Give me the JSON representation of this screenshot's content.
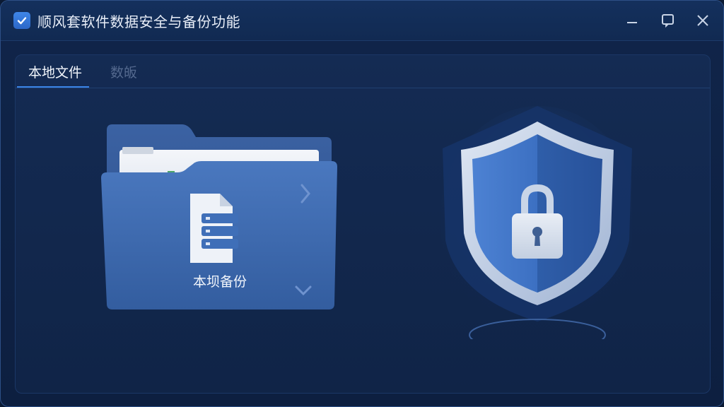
{
  "window": {
    "title": "顺风套软件数据安全与备份功能",
    "controls": [
      "minimize-icon",
      "restore-icon",
      "close-icon"
    ]
  },
  "tabs": [
    {
      "label": "本地文件",
      "active": true
    },
    {
      "label": "数皈",
      "active": false
    }
  ],
  "main": {
    "folder_card": {
      "label": "本坝备份",
      "icon": "folder-icon"
    },
    "shield": {
      "icon": "shield-lock-icon"
    }
  },
  "colors": {
    "accent": "#3b84e6",
    "background": "#0d1f40",
    "panel": "#142b53",
    "folder": "#3d68ad",
    "shield": "#2f63b8"
  }
}
